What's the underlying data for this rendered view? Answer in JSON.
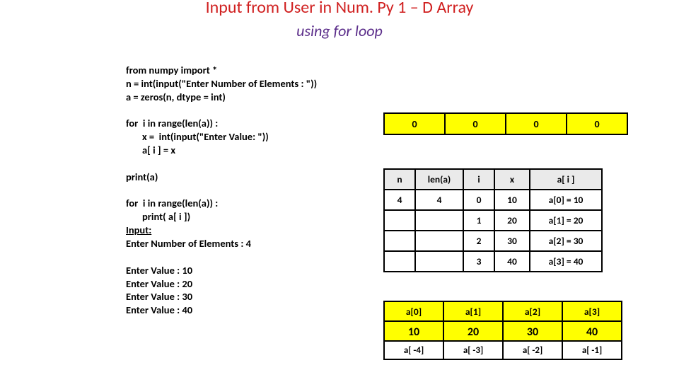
{
  "title": "Input  from User in Num. Py 1 – D Array",
  "subtitle": "using for loop",
  "code": {
    "l1": "from numpy import *",
    "l2": "n = int(input(\"Enter Number of Elements : \"))",
    "l3": "a = zeros(n, dtype = int)",
    "l4": "",
    "l5": "for  i in range(len(a)) :",
    "l6": "       x =  int(input(\"Enter Value: \"))",
    "l7": "       a[ i ] = x",
    "l8": "",
    "l9": "print(a)",
    "l10": "",
    "l11": "for  i in range(len(a)) :",
    "l12": "       print( a[ i ])",
    "l13_label": "Input:",
    "l14": "Enter Number of Elements : 4",
    "l15": "",
    "l16": "Enter Value : 10",
    "l17": "Enter Value : 20",
    "l18": "Enter Value : 30",
    "l19": "Enter Value : 40"
  },
  "zeros": [
    "0",
    "0",
    "0",
    "0"
  ],
  "trace": {
    "headers": [
      "n",
      "len(a)",
      "i",
      "x",
      "a[ i ]"
    ],
    "rows": [
      [
        "4",
        "4",
        "0",
        "10",
        "a[0] = 10"
      ],
      [
        "",
        "",
        "1",
        "20",
        "a[1] = 20"
      ],
      [
        "",
        "",
        "2",
        "30",
        "a[2] = 30"
      ],
      [
        "",
        "",
        "3",
        "40",
        "a[3] = 40"
      ]
    ]
  },
  "final": {
    "pos": [
      "a[0]",
      "a[1]",
      "a[2]",
      "a[3]"
    ],
    "vals": [
      "10",
      "20",
      "30",
      "40"
    ],
    "neg": [
      "a[ -4]",
      "a[ -3]",
      "a[ -2]",
      "a[ -1]"
    ]
  }
}
